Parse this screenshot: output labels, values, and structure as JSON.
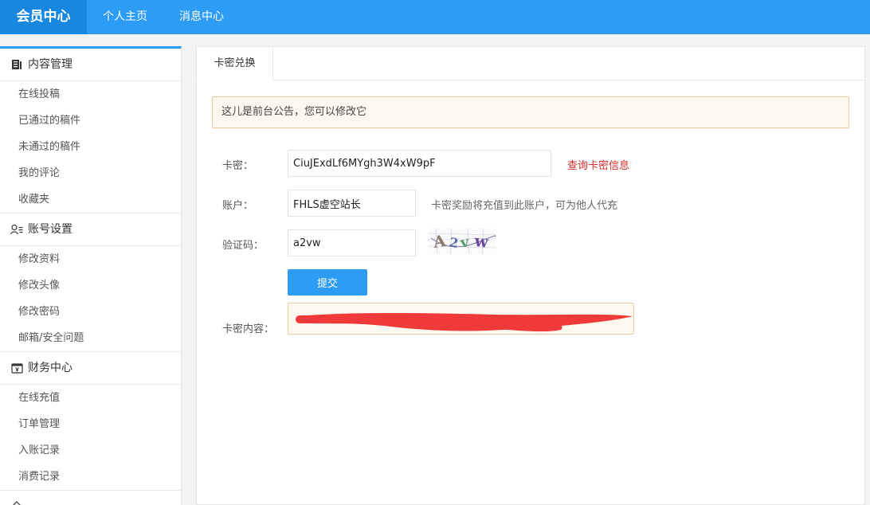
{
  "header": {
    "brand": "会员中心",
    "nav": [
      "个人主页",
      "消息中心"
    ]
  },
  "sidebar": {
    "groups": [
      {
        "title": "内容管理",
        "icon": "document-icon",
        "items": [
          "在线投稿",
          "已通过的稿件",
          "未通过的稿件",
          "我的评论",
          "收藏夹"
        ]
      },
      {
        "title": "账号设置",
        "icon": "user-settings-icon",
        "items": [
          "修改资料",
          "修改头像",
          "修改密码",
          "邮箱/安全问题"
        ]
      },
      {
        "title": "财务中心",
        "icon": "wallet-icon",
        "items": [
          "在线充值",
          "订单管理",
          "入账记录",
          "消费记录"
        ]
      }
    ]
  },
  "main": {
    "tab": "卡密兑换",
    "notice": "这儿是前台公告，您可以修改它",
    "form": {
      "card_label": "卡密：",
      "card_value": "CiuJExdLf6MYgh3W4xW9pF",
      "query_link": "查询卡密信息",
      "account_label": "账户：",
      "account_value": "FHLS虚空站长",
      "account_hint": "卡密奖励将充值到此账户，可为他人代充",
      "captcha_label": "验证码：",
      "captcha_value": "a2vw",
      "captcha_image_text": "A2vw",
      "submit": "提交",
      "content_label": "卡密内容："
    }
  },
  "colors": {
    "accent": "#2d9cf5",
    "brand_bg": "#1787e0",
    "link_red": "#d62b2b",
    "redaction": "#f03a3a"
  }
}
